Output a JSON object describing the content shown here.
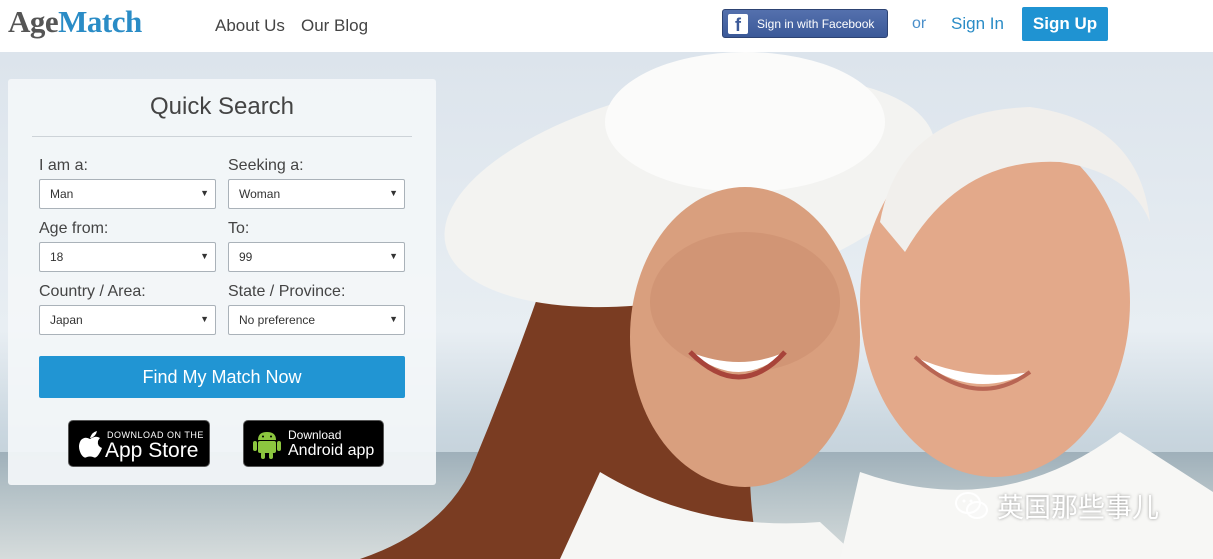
{
  "header": {
    "logo_part1": "Age",
    "logo_part2": "Match",
    "nav": {
      "about": "About Us",
      "blog": "Our Blog"
    },
    "facebook_label": "Sign in with Facebook",
    "or_text": "or",
    "signin_label": "Sign In",
    "signup_label": "Sign Up"
  },
  "search": {
    "title": "Quick Search",
    "i_am_label": "I am a:",
    "i_am_value": "Man",
    "seeking_label": "Seeking a:",
    "seeking_value": "Woman",
    "age_from_label": "Age from:",
    "age_from_value": "18",
    "to_label": "To:",
    "to_value": "99",
    "country_label": "Country / Area:",
    "country_value": "Japan",
    "state_label": "State / Province:",
    "state_value": "No preference",
    "find_button": "Find My Match Now"
  },
  "apps": {
    "appstore_small": "DOWNLOAD ON THE",
    "appstore_big": "App Store",
    "android_small": "Download",
    "android_big": "Android app"
  },
  "watermark": "英国那些事儿",
  "colors": {
    "brand_blue": "#2195d3",
    "facebook": "#3b5998"
  }
}
